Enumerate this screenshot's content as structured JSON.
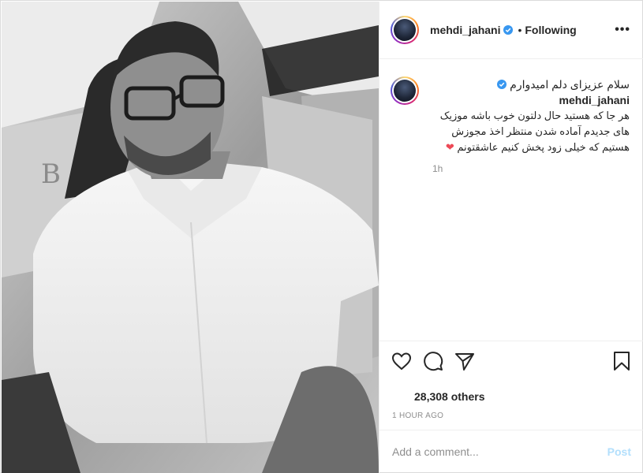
{
  "post": {
    "username": "mehdi_jahani",
    "verified": true,
    "follow_status": "Following",
    "separator": "•",
    "more_label": "•••",
    "caption_line1": "سلام عزیزای دلم امیدوارم",
    "caption_rest": "هر جا که هستید حال دلتون خوب باشه موزیک های جدیدم آماده شدن منتظر اخذ مجوزش هستیم که خیلی زود پخش کنیم عاشقتونم",
    "caption_emoji": "❤",
    "caption_age": "1h",
    "likes_count": "28,308 others",
    "posted_time": "1 HOUR AGO"
  },
  "comment": {
    "placeholder": "Add a comment...",
    "post_label": "Post"
  },
  "icons": {
    "like": "heart-outline-icon",
    "comment": "comment-bubble-icon",
    "share": "paper-plane-icon",
    "save": "bookmark-icon",
    "verified": "verified-badge-icon"
  },
  "colors": {
    "verified": "#3897f0",
    "heart_emoji": "#ed4956",
    "post_button": "#b2dffc",
    "muted": "#8e8e8e"
  }
}
